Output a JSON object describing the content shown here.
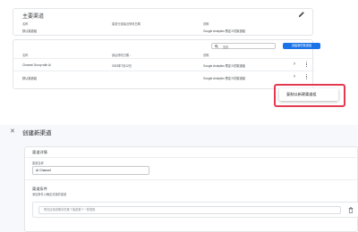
{
  "main_group": {
    "title": "主要渠道",
    "edit_icon": "pencil-icon",
    "headers": [
      "名称",
      "渠道分组最近修改日期",
      "说明"
    ],
    "values": [
      "默认渠道组",
      "",
      "Google Analytics 预定义的渠道组"
    ]
  },
  "table": {
    "search_placeholder": "搜索",
    "create_button": "创建新的渠道组",
    "headers": [
      "名称",
      "最后修改日期 ↓",
      "说明"
    ],
    "rows": [
      {
        "name": "Channel Group with AI",
        "date": "2023年7月12日",
        "desc": "Google Analytics 预定义的渠道组"
      },
      {
        "name": "默认渠道组",
        "date": "",
        "desc": "Google Analytics 预定义的渠道组"
      }
    ]
  },
  "context_menu": {
    "item": "复制以新建渠道组"
  },
  "highlight_color": "#e53950",
  "accent_color": "#1a73e8",
  "create_channel": {
    "page_title": "创建新渠道",
    "section_title": "渠道详情",
    "name_label": "渠道名称",
    "name_value": "AI Channel",
    "condition_title": "渠道条件",
    "condition_desc": "添加条件以确定流量的渠道",
    "condition_placeholder": "所在区域说明中的某个值或某个一些规则"
  }
}
